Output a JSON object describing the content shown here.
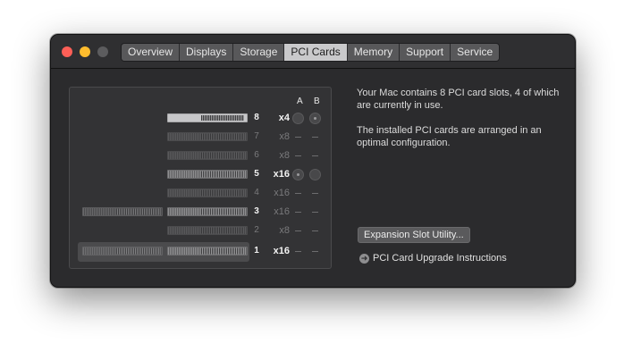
{
  "tabs": [
    {
      "label": "Overview"
    },
    {
      "label": "Displays"
    },
    {
      "label": "Storage"
    },
    {
      "label": "PCI Cards",
      "active": true
    },
    {
      "label": "Memory"
    },
    {
      "label": "Support"
    },
    {
      "label": "Service"
    }
  ],
  "columns": {
    "a": "A",
    "b": "B"
  },
  "slots": [
    {
      "number": "8",
      "lanes": "x4",
      "active": true,
      "a": "indicator",
      "b": "indicator-dot",
      "card": "solid"
    },
    {
      "number": "7",
      "lanes": "x8",
      "active": false,
      "a": "—",
      "b": "—",
      "card": "empty"
    },
    {
      "number": "6",
      "lanes": "x8",
      "active": false,
      "a": "—",
      "b": "—",
      "card": "empty"
    },
    {
      "number": "5",
      "lanes": "x16",
      "active": true,
      "a": "indicator-dot",
      "b": "indicator",
      "card": "installed"
    },
    {
      "number": "4",
      "lanes": "x16",
      "active": false,
      "a": "—",
      "b": "—",
      "card": "empty"
    },
    {
      "number": "3",
      "lanes": "x16",
      "active": true,
      "a": "—",
      "b": "—",
      "card": "installed-wide"
    },
    {
      "number": "2",
      "lanes": "x8",
      "active": false,
      "a": "—",
      "b": "—",
      "card": "empty"
    },
    {
      "number": "1",
      "lanes": "x16",
      "active": true,
      "a": "—",
      "b": "—",
      "card": "installed-wide",
      "selected": true
    }
  ],
  "info": {
    "summary": "Your Mac contains 8 PCI card slots, 4 of which are currently in use.",
    "arrangement": "The installed PCI cards are arranged in an optimal configuration."
  },
  "buttons": {
    "expansion_slot_utility": "Expansion Slot Utility..."
  },
  "links": {
    "upgrade_instructions": "PCI Card Upgrade Instructions"
  },
  "icons": {
    "link": "arrow-circle-right-icon"
  },
  "colors": {
    "close": "#fe5f57",
    "minimize": "#febc2e",
    "zoom": "#5c5c5e"
  }
}
